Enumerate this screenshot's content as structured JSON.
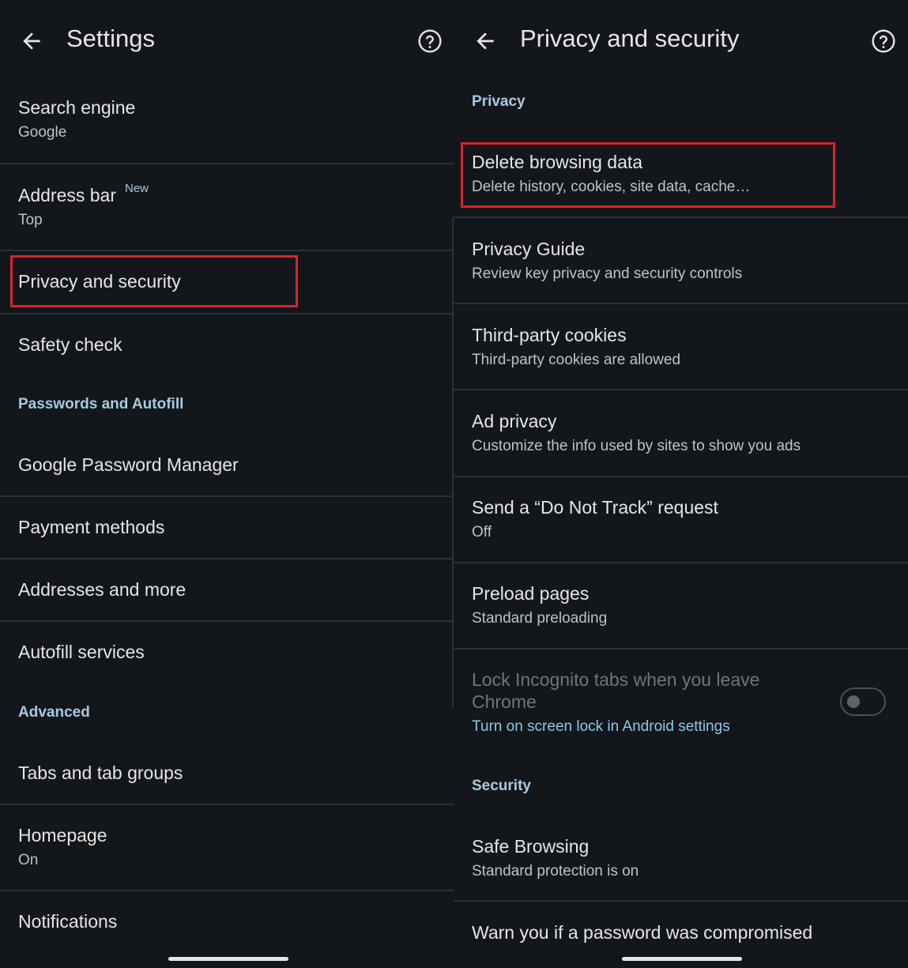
{
  "left": {
    "title": "Settings",
    "rows": [
      {
        "title": "Search engine",
        "subtitle": "Google"
      },
      {
        "title": "Address bar",
        "subtitle": "Top",
        "badge": "New"
      },
      {
        "title": "Privacy and security"
      },
      {
        "title": "Safety check"
      },
      {
        "title": "Google Password Manager"
      },
      {
        "title": "Payment methods"
      },
      {
        "title": "Addresses and more"
      },
      {
        "title": "Autofill services"
      },
      {
        "title": "Tabs and tab groups"
      },
      {
        "title": "Homepage",
        "subtitle": "On"
      },
      {
        "title": "Notifications"
      }
    ],
    "sections": {
      "passwords": "Passwords and Autofill",
      "advanced": "Advanced"
    }
  },
  "right": {
    "title": "Privacy and security",
    "sections": {
      "privacy": "Privacy",
      "security": "Security"
    },
    "rows": [
      {
        "title": "Delete browsing data",
        "subtitle": "Delete history, cookies, site data, cache…"
      },
      {
        "title": "Privacy Guide",
        "subtitle": "Review key privacy and security controls"
      },
      {
        "title": "Third-party cookies",
        "subtitle": "Third-party cookies are allowed"
      },
      {
        "title": "Ad privacy",
        "subtitle": "Customize the info used by sites to show you ads"
      },
      {
        "title": "Send a “Do Not Track” request",
        "subtitle": "Off"
      },
      {
        "title": "Preload pages",
        "subtitle": "Standard preloading"
      },
      {
        "title_line1": "Lock Incognito tabs when you leave",
        "title_line2": "Chrome",
        "subtitle": "Turn on screen lock in Android settings",
        "toggle_on": false
      },
      {
        "title": "Safe Browsing",
        "subtitle": "Standard protection is on"
      },
      {
        "title": "Warn you if a password was compromised"
      }
    ]
  },
  "colors": {
    "background": "#13171b",
    "accent": "#a6cbe0",
    "highlight": "#d6262d"
  },
  "icons": [
    "back-arrow-icon",
    "help-circle-icon"
  ]
}
